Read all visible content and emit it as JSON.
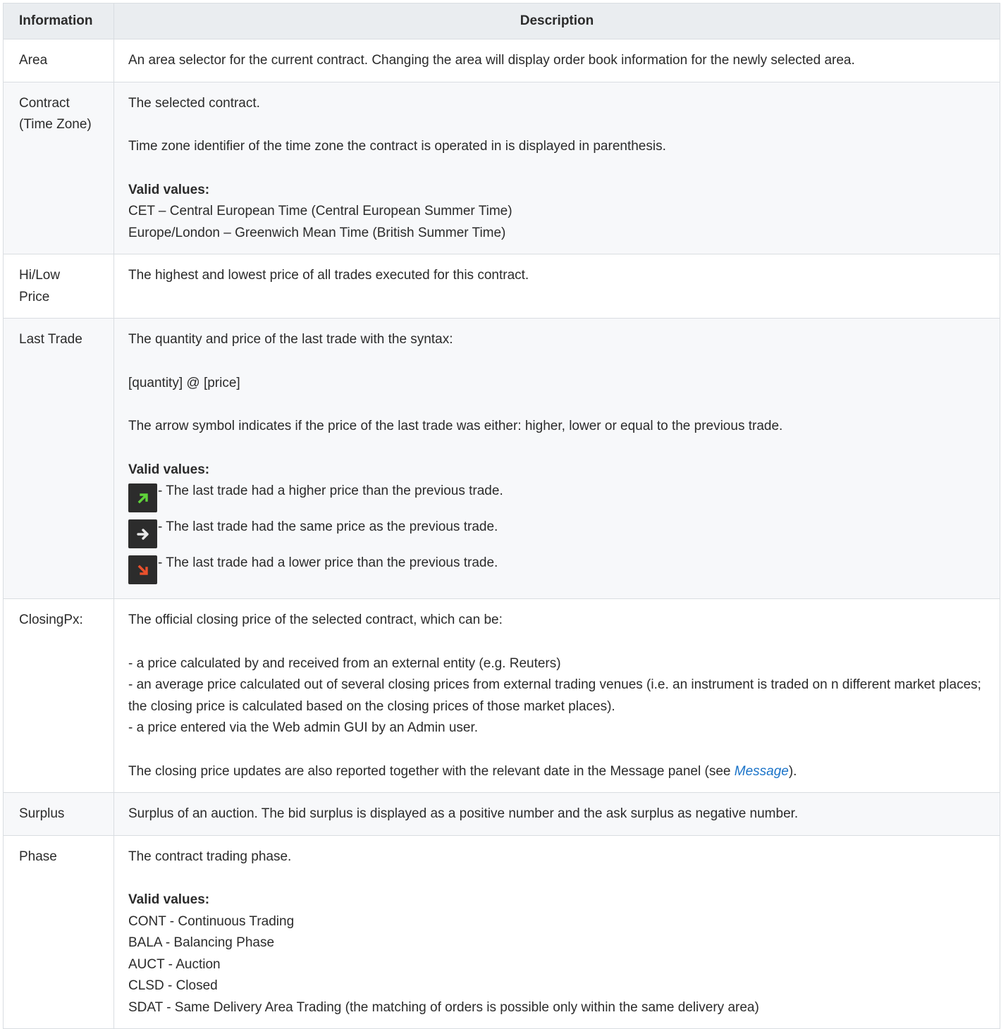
{
  "headers": {
    "information": "Information",
    "description": "Description"
  },
  "rows": {
    "area": {
      "label": "Area",
      "text": "An area selector for the current contract. Changing the area will display order book information for the newly selected area."
    },
    "contract": {
      "label1": "Contract",
      "label2": "(Time Zone)",
      "p1": "The selected contract.",
      "p2": "Time zone identifier of the time zone the contract is operated in is displayed in parenthesis.",
      "valid": "Valid values:",
      "v1": "CET – Central European Time (Central European Summer Time)",
      "v2": "Europe/London – Greenwich Mean Time (British Summer Time)"
    },
    "hilow": {
      "label1": "Hi/Low",
      "label2": "Price",
      "text": "The highest and lowest price of all trades executed for this contract."
    },
    "lasttrade": {
      "label": "Last Trade",
      "p1": "The quantity and price of the last trade with the syntax:",
      "p2": "[quantity] @ [price]",
      "p3": "The arrow symbol indicates if the price of the last trade was either: higher, lower or equal to the previous trade.",
      "valid": "Valid values:",
      "up": {
        "icon": "arrow-up-right-green-icon",
        "color": "#5fd33a",
        "text": "- The last trade had a higher price than the previous trade."
      },
      "same": {
        "icon": "arrow-right-white-icon",
        "color": "#e8e8e8",
        "text": "- The last trade had the same price as the previous trade."
      },
      "down": {
        "icon": "arrow-down-right-red-icon",
        "color": "#e9502c",
        "text": "- The last trade had a lower price than the previous trade."
      }
    },
    "closing": {
      "label": "ClosingPx:",
      "p1": "The official closing price of the selected contract, which can be:",
      "l1": "- a price calculated by and received from an external entity (e.g. Reuters)",
      "l2": "- an average price calculated out of several closing prices from external trading venues (i.e. an instrument is traded on n different market places; the closing price is calculated based on the closing prices of those market places).",
      "l3": "- a price entered via the Web admin GUI by an Admin user.",
      "p2a": "The closing price updates are also reported together with the relevant date in the Message panel (see ",
      "link": "Message",
      "p2b": ")."
    },
    "surplus": {
      "label": "Surplus",
      "text": "Surplus of an auction. The bid surplus is displayed as a positive number and the ask surplus as negative number."
    },
    "phase": {
      "label": "Phase",
      "p1": "The contract trading phase.",
      "valid": "Valid values:",
      "values": [
        "CONT - Continuous Trading",
        "BALA - Balancing Phase",
        "AUCT - Auction",
        "CLSD - Closed",
        "SDAT - Same Delivery Area Trading (the matching of orders is possible only within the same delivery area)"
      ]
    }
  }
}
